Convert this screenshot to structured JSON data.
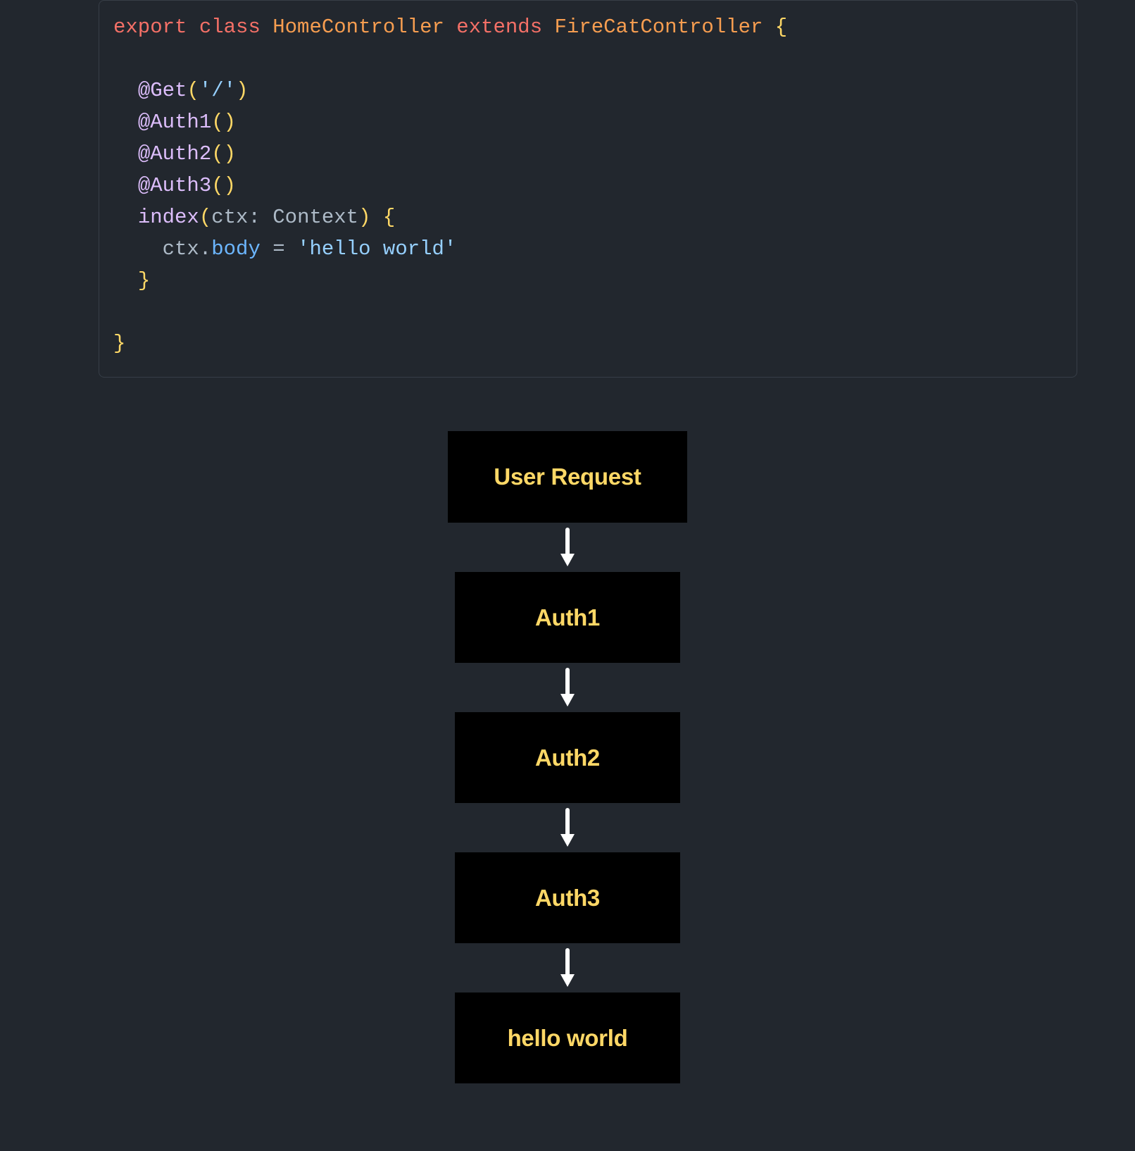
{
  "code": {
    "kw_export": "export",
    "kw_class": "class",
    "class_name": "HomeController",
    "kw_extends": "extends",
    "base_class": "FireCatController",
    "brace_open": "{",
    "brace_close": "}",
    "at": "@",
    "dec_get": "Get",
    "dec_get_arg": "'/'",
    "dec_auth1": "Auth1",
    "dec_auth2": "Auth2",
    "dec_auth3": "Auth3",
    "paren_open": "(",
    "paren_close": ")",
    "method_name": "index",
    "param_name": "ctx",
    "colon": ":",
    "param_type": "Context",
    "ctx": "ctx",
    "dot": ".",
    "body_prop": "body",
    "equals": "=",
    "body_value": "'hello world'"
  },
  "diagram": {
    "box1": "User Request",
    "box2": "Auth1",
    "box3": "Auth2",
    "box4": "Auth3",
    "box5": "hello world"
  }
}
